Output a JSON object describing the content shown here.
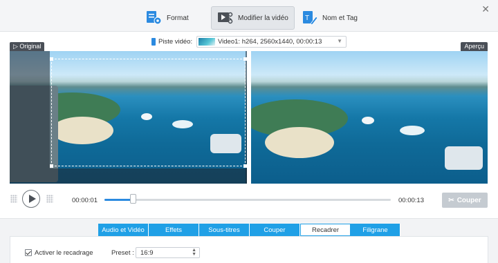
{
  "window": {
    "close_glyph": "✕"
  },
  "top_tabs": [
    {
      "label": "Format",
      "icon": "format-settings-icon",
      "active": false
    },
    {
      "label": "Modifier la vidéo",
      "icon": "video-edit-icon",
      "active": true
    },
    {
      "label": "Nom et Tag",
      "icon": "tag-edit-icon",
      "active": false
    }
  ],
  "track": {
    "label": "Piste vidéo:",
    "value": "Video1: h264, 2560x1440, 00:00:13"
  },
  "preview": {
    "original_label": "Original",
    "apercu_label": "Aperçu"
  },
  "player": {
    "current_time": "00:00:01",
    "end_time": "00:00:13",
    "progress_fraction": 0.1,
    "cut_label": "Couper"
  },
  "subtabs": [
    {
      "label": "Audio et Vidéo",
      "active": false
    },
    {
      "label": "Effets",
      "active": false
    },
    {
      "label": "Sous-titres",
      "active": false
    },
    {
      "label": "Couper",
      "active": false
    },
    {
      "label": "Recadrer",
      "active": true
    },
    {
      "label": "Filigrane",
      "active": false
    }
  ],
  "crop": {
    "enable_label": "Activer le recadrage",
    "enabled": true,
    "preset_label": "Preset :",
    "preset_value": "16:9"
  },
  "colors": {
    "accent": "#20a0e6",
    "progress": "#2b8ae0",
    "cut_disabled": "#c5cbd1"
  }
}
